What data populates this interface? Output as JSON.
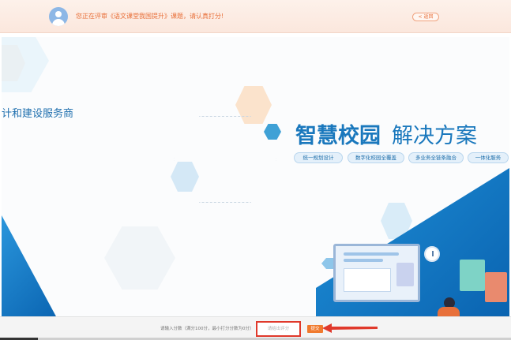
{
  "topbar": {
    "notice": "您正在评审《语文课堂我国提升》课题，请认真打分!",
    "back_label": "< 返回"
  },
  "banner": {
    "left_tagline": "计和建设服务商",
    "title_bold": "智慧校园",
    "title_light": "解决方案",
    "tags": [
      "统一规划设计",
      "数字化校园全覆盖",
      "多业务全链条融合",
      "一体化服务"
    ]
  },
  "rating": {
    "prompt": "请输入分数（满分100分，最小打分分数为0分）",
    "input_placeholder": "请给出评分",
    "submit_label": "提交"
  },
  "colors": {
    "accent_orange": "#e8703a",
    "brand_blue": "#1a78bd",
    "highlight_red": "#e0392b"
  }
}
